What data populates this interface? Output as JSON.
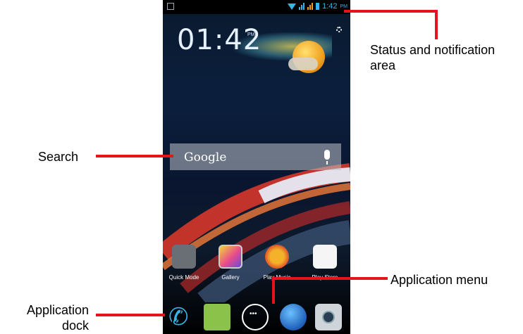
{
  "status_bar": {
    "time": "1:42",
    "ampm": "PM"
  },
  "clock_widget": {
    "time": "01:42",
    "ampm": "PM"
  },
  "search": {
    "label": "Google"
  },
  "apps": [
    {
      "label": "Quick Mode"
    },
    {
      "label": "Gallery"
    },
    {
      "label": "Play Music"
    },
    {
      "label": "Play Store"
    }
  ],
  "callouts": {
    "status": "Status and notification area",
    "search": "Search",
    "app_menu": "Application menu",
    "dock": "Application dock"
  },
  "colors": {
    "callout_line": "#e5141a",
    "status_accent": "#3ab4e6"
  }
}
